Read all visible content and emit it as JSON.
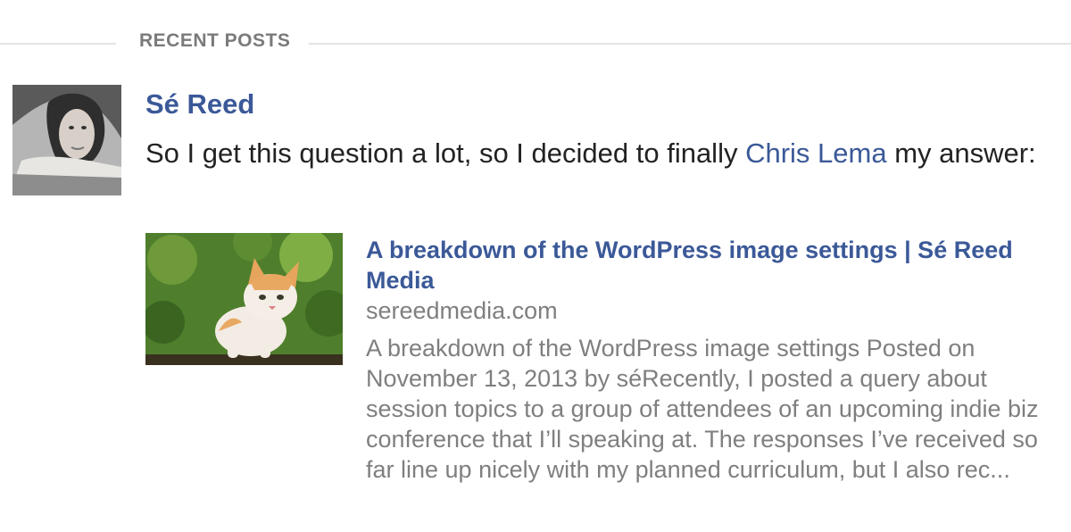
{
  "section": {
    "title": "RECENT POSTS"
  },
  "post": {
    "author": "Sé Reed",
    "text_before": "So I get this question a lot, so I decided to finally ",
    "mention": "Chris Lema",
    "text_after": " my answer:",
    "link": {
      "title": "A breakdown of the WordPress image settings | Sé Reed Media",
      "domain": "sereedmedia.com",
      "description": "A breakdown of the WordPress image settings Posted on November 13, 2013 by séRecently, I posted a query about session topics to a group of attendees of an upcoming indie biz conference that I’ll speaking at. The responses I’ve received so far line up nicely with my planned curriculum, but I also rec..."
    }
  },
  "colors": {
    "link": "#3b5998",
    "muted": "#7f7f7f",
    "text": "#222222",
    "rule": "#e4e4e4"
  },
  "icons": {
    "avatar": "author-avatar-photo",
    "thumbnail": "kitten-photo"
  }
}
